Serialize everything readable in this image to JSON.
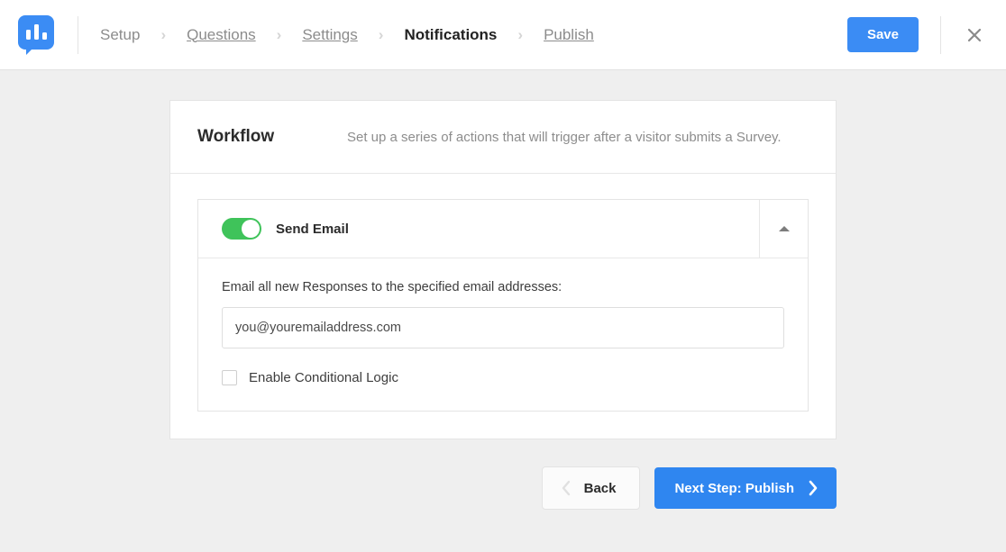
{
  "header": {
    "logo_icon": "survey-chart-bubble-logo",
    "breadcrumb": [
      {
        "label": "Setup",
        "state": "visited-plain"
      },
      {
        "label": "Questions",
        "state": "link"
      },
      {
        "label": "Settings",
        "state": "link"
      },
      {
        "label": "Notifications",
        "state": "active"
      },
      {
        "label": "Publish",
        "state": "link"
      }
    ],
    "separator": "›",
    "save_label": "Save",
    "close_icon": "close-icon",
    "accent_color": "#3b8cf4"
  },
  "workflow": {
    "title": "Workflow",
    "description": "Set up a series of actions that will trigger after a visitor submits a Survey."
  },
  "action": {
    "enabled": true,
    "toggle_color": "#3fc35a",
    "label": "Send Email",
    "collapse_icon": "caret-up-icon",
    "field_label": "Email all new Responses to the specified email addresses:",
    "email_value": "you@youremailaddress.com",
    "email_placeholder": "you@youremailaddress.com",
    "checkbox_checked": false,
    "checkbox_label": "Enable Conditional Logic"
  },
  "footer": {
    "back_label": "Back",
    "back_icon": "chevron-left-icon",
    "next_label": "Next Step: Publish",
    "next_icon": "chevron-right-icon",
    "next_color": "#2f86f0"
  }
}
